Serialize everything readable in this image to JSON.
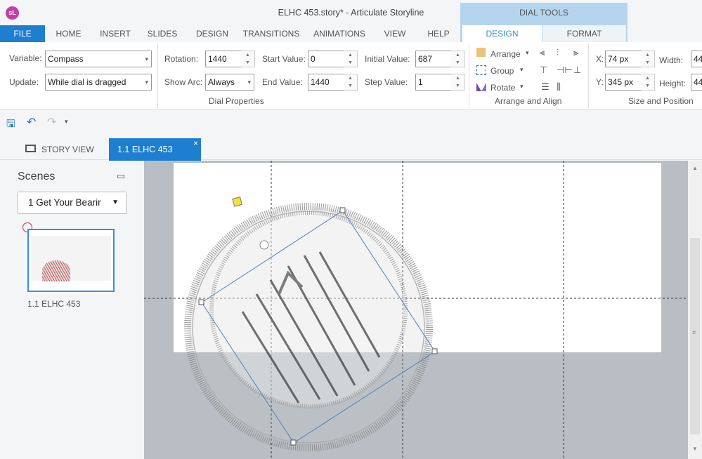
{
  "window": {
    "title": "ELHC 453.story* -  Articulate Storyline",
    "logo": "sL"
  },
  "menu": {
    "tabs": [
      "FILE",
      "HOME",
      "INSERT",
      "SLIDES",
      "DESIGN",
      "TRANSITIONS",
      "ANIMATIONS",
      "VIEW",
      "HELP"
    ],
    "context_group": "DIAL TOOLS",
    "context_tabs": [
      "DESIGN",
      "FORMAT"
    ]
  },
  "dial_properties": {
    "group_label": "Dial Properties",
    "variable_label": "Variable:",
    "variable": "Compass",
    "update_label": "Update:",
    "update": "While dial is dragged",
    "rotation_label": "Rotation:",
    "rotation": "1440",
    "show_arc_label": "Show Arc:",
    "show_arc": "Always",
    "start_label": "Start Value:",
    "start": "0",
    "end_label": "End Value:",
    "end": "1440",
    "initial_label": "Initial Value:",
    "initial": "687",
    "step_label": "Step Value:",
    "step": "1"
  },
  "arrange": {
    "group_label": "Arrange and Align",
    "arrange": "Arrange",
    "group": "Group",
    "rotate": "Rotate"
  },
  "size_position": {
    "group_label": "Size and Position",
    "x_label": "X:",
    "x": "74 px",
    "y_label": "Y:",
    "y": "345 px",
    "width_label": "Width:",
    "width": "44",
    "height_label": "Height:",
    "height": "44"
  },
  "doc_tabs": {
    "story_view": "STORY VIEW",
    "slide_tab": "1.1 ELHC 453",
    "close": "×"
  },
  "scenes": {
    "title": "Scenes",
    "selected": "1 Get Your Bearir",
    "slide_label": "1.1 ELHC 453"
  },
  "colors": {
    "accent": "#1e7fd0",
    "context": "#b5d5ee",
    "selection": "#5b7fb5"
  }
}
